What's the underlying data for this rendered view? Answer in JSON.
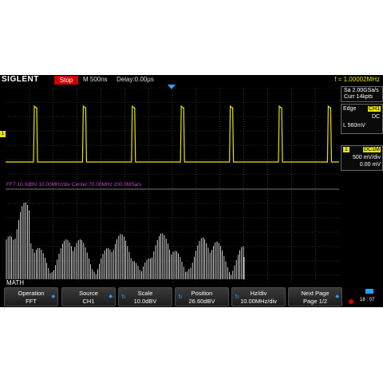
{
  "topbar": {
    "brand": "SIGLENT",
    "run_status": "Stop",
    "timebase": "M 500ns",
    "delay": "Delay:0.00μs",
    "frequency": "f = 1.00002MHz"
  },
  "acquisition": {
    "sample_rate": "Sa 2.00GSa/s",
    "memory": "Curr 14kpts"
  },
  "trigger": {
    "type": "Edge",
    "source": "CH1",
    "coupling": "DC",
    "level": "L  560mV"
  },
  "channel1": {
    "number": "1",
    "coupling": "DC1M",
    "scale": "500 mV/div",
    "offset": "0.00 mV",
    "color": "#e6e600"
  },
  "fft": {
    "info": "FFT  10.0dBV  10.00MHz/div  Center:70.00MHz   200.0MSa/s",
    "color": "#cc44cc"
  },
  "math_label": "MATH",
  "menu": [
    {
      "title": "Operation",
      "value": "FFT",
      "icon": "arrow-icon"
    },
    {
      "title": "Source",
      "value": "CH1",
      "icon": "arrow-icon"
    },
    {
      "title": "Scale",
      "value": "10.0dBV",
      "icon": "knob-icon"
    },
    {
      "title": "Position",
      "value": "26.60dBV",
      "icon": "knob-icon"
    },
    {
      "title": "Hz/div",
      "value": "10.00MHz/div",
      "icon": "knob-icon"
    },
    {
      "title": "Next Page",
      "value": "Page 1/2",
      "icon": "arrow-icon"
    }
  ],
  "status": {
    "time": "18 : 07"
  },
  "colors": {
    "trace": "#e6e600",
    "fft_trace": "#ffffff",
    "grid": "#555555",
    "accent": "#2aa0ff",
    "stop": "#d00000"
  }
}
